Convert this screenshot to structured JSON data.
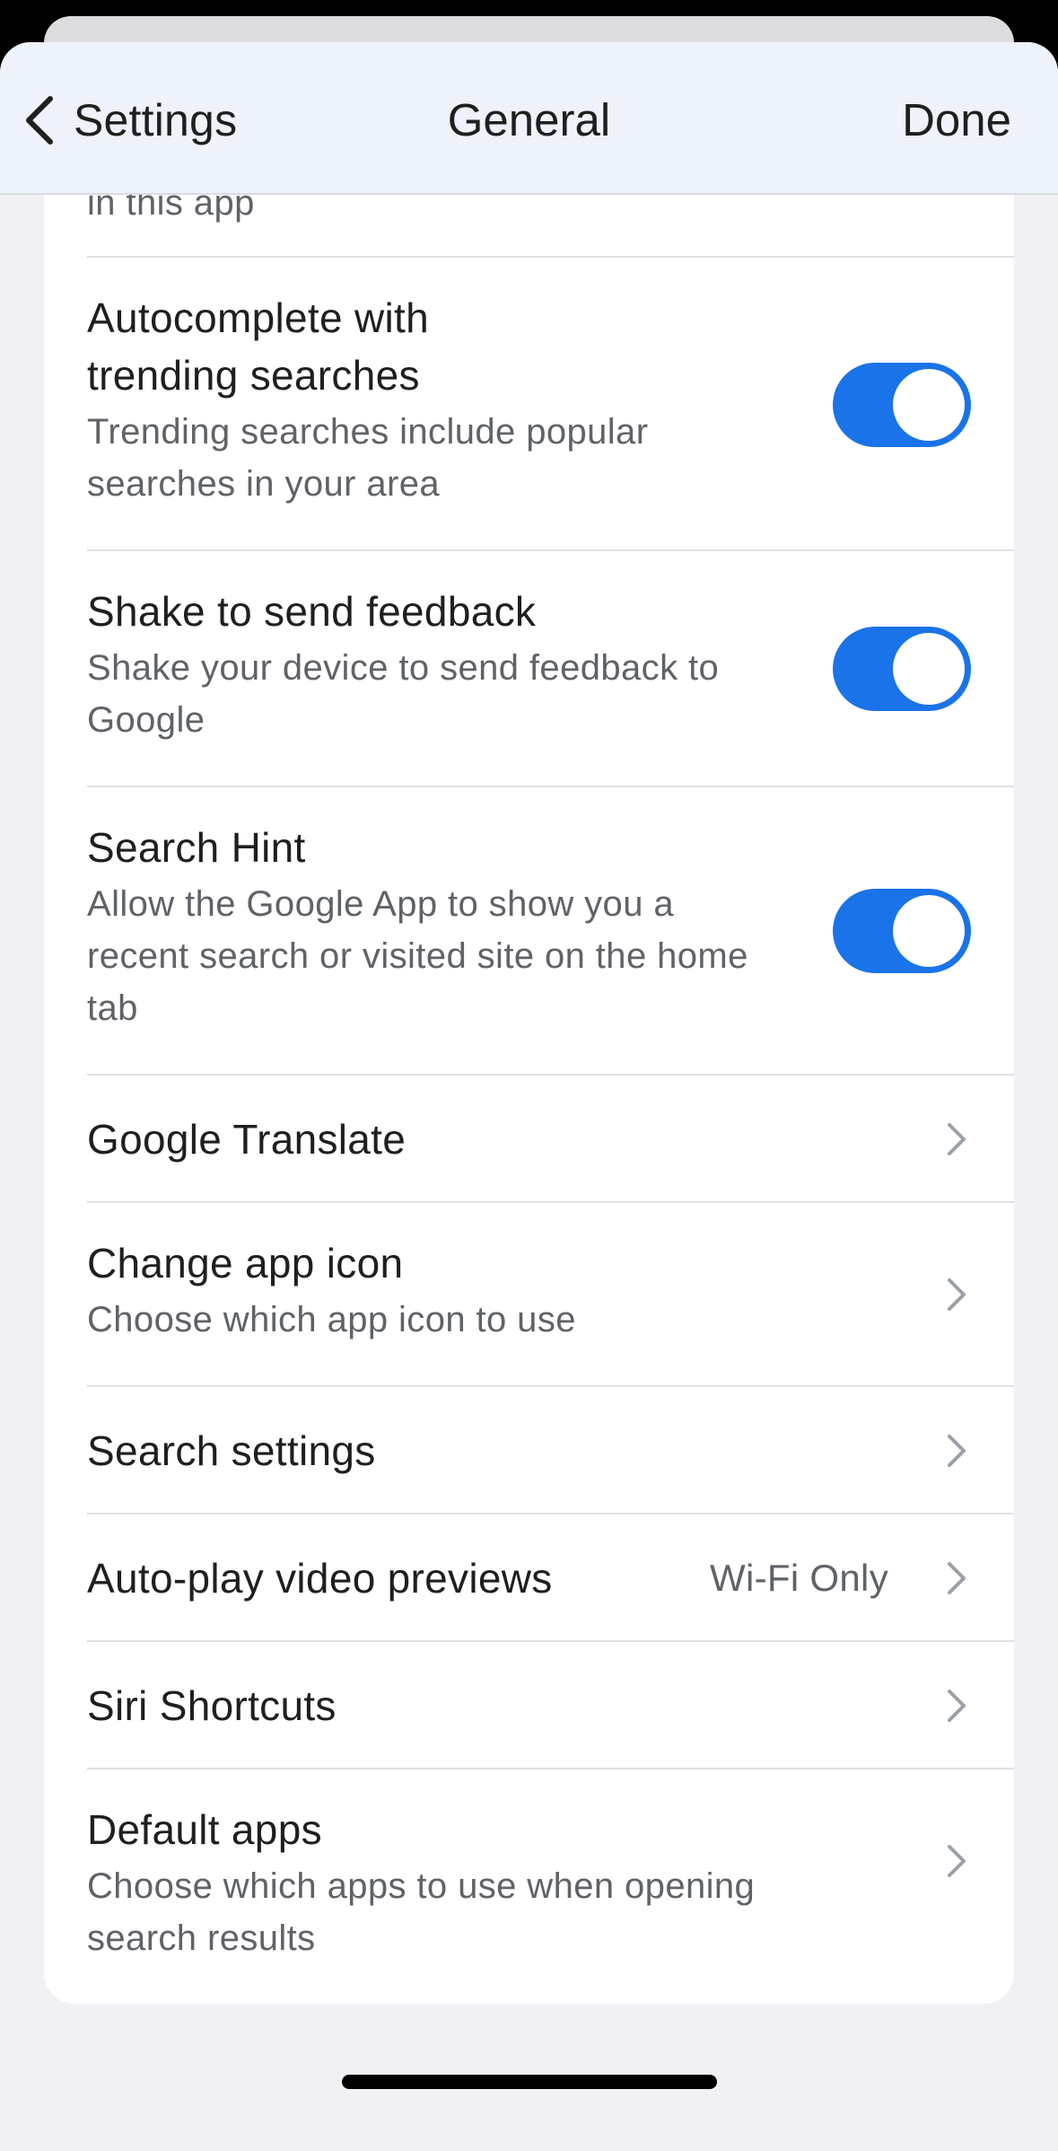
{
  "nav": {
    "back_label": "Settings",
    "title": "General",
    "done_label": "Done"
  },
  "rows": [
    {
      "title": "",
      "subtitle": "in this app",
      "type": "clipped"
    },
    {
      "title": "Autocomplete with trending searches",
      "subtitle": "Trending searches include popular searches in your area",
      "type": "toggle",
      "on": true
    },
    {
      "title": "Shake to send feedback",
      "subtitle": "Shake your device to send feedback to Google",
      "type": "toggle",
      "on": true
    },
    {
      "title": "Search Hint",
      "subtitle": "Allow the Google App to show you a recent search or visited site on the home tab",
      "type": "toggle",
      "on": true
    },
    {
      "title": "Google Translate",
      "type": "link"
    },
    {
      "title": "Change app icon",
      "subtitle": "Choose which app icon to use",
      "type": "link"
    },
    {
      "title": "Search settings",
      "type": "link"
    },
    {
      "title": "Auto-play video previews",
      "value": "Wi-Fi Only",
      "type": "link"
    },
    {
      "title": "Siri Shortcuts",
      "type": "link"
    },
    {
      "title": "Default apps",
      "subtitle": "Choose which apps to use when opening search results",
      "type": "link"
    }
  ],
  "colors": {
    "toggle_on": "#1a73e8",
    "background": "#f0f0f5",
    "nav_background": "#eef2fa"
  },
  "icons": {
    "back": "chevron-left-icon",
    "row_link": "chevron-right-icon"
  }
}
